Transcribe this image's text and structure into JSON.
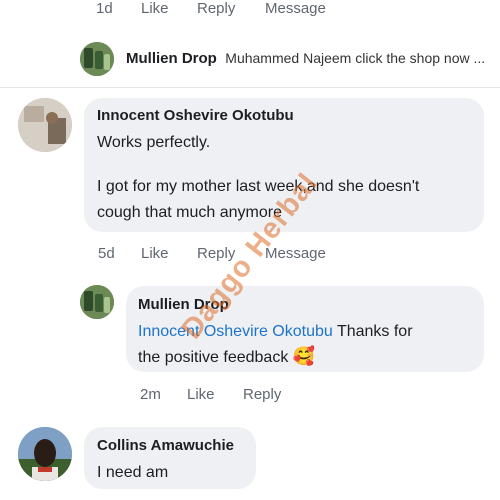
{
  "top_actions": {
    "time": "1d",
    "like": "Like",
    "reply": "Reply",
    "message": "Message"
  },
  "reply1": {
    "name": "Mullien Drop",
    "text": "Muhammed Najeem click the shop now ..."
  },
  "comment2": {
    "name": "Innocent Oshevire Okotubu",
    "line1": "Works perfectly.",
    "line2": "I got for my mother last week,and she doesn't",
    "line3": "cough that much anymore"
  },
  "actions2": {
    "time": "5d",
    "like": "Like",
    "reply": "Reply",
    "message": "Message"
  },
  "reply2": {
    "name": "Mullien Drop",
    "mention": "Innocent Oshevire Okotubu",
    "text_after": "Thanks for",
    "line2": "the positive feedback",
    "emoji": "🥰"
  },
  "actions3": {
    "time": "2m",
    "like": "Like",
    "reply": "Reply"
  },
  "comment3": {
    "name": "Collins Amawuchie",
    "text": "I need  am"
  },
  "watermark": "Daggo Herbal"
}
